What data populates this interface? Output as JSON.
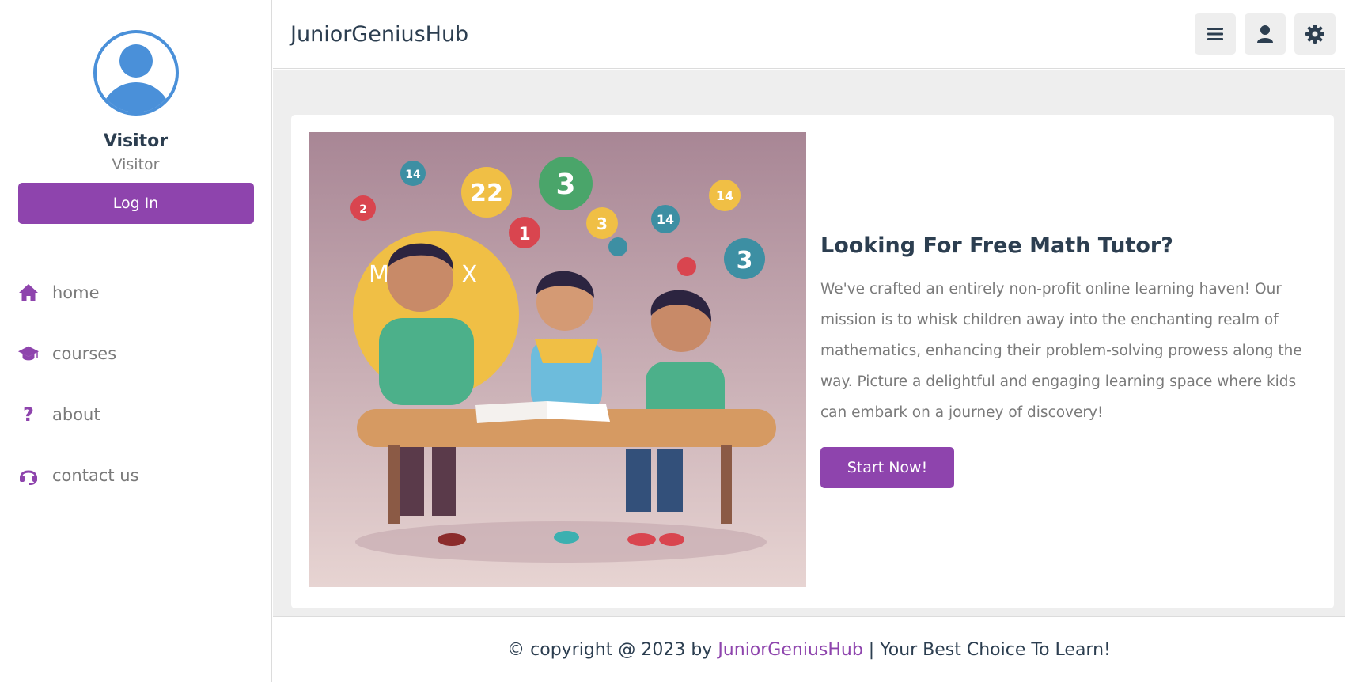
{
  "sidebar": {
    "profile": {
      "name": "Visitor",
      "role": "Visitor",
      "login_label": "Log In"
    },
    "nav": [
      {
        "label": "home",
        "icon": "home-icon"
      },
      {
        "label": "courses",
        "icon": "graduation-cap-icon"
      },
      {
        "label": "about",
        "icon": "question-icon"
      },
      {
        "label": "contact us",
        "icon": "headset-icon"
      }
    ]
  },
  "header": {
    "brand": "JuniorGeniusHub",
    "actions": [
      "menu-icon",
      "user-icon",
      "settings-icon"
    ]
  },
  "hero": {
    "title": "Looking For Free Math Tutor?",
    "description": "We've crafted an entirely non-profit online learning haven! Our mission is to whisk children away into the enchanting realm of mathematics, enhancing their problem-solving prowess along the way. Picture a delightful and engaging learning space where kids can embark on a journey of discovery!",
    "cta_label": "Start Now!",
    "image_subject": "three kids studying math at a table",
    "image_numbers": [
      "14",
      "22",
      "3",
      "1",
      "3",
      "14",
      "14",
      "3",
      "2",
      "M",
      "X"
    ]
  },
  "footer": {
    "prefix": "© copyright @ 2023 by ",
    "brand": "JuniorGeniusHub",
    "suffix": " | Your Best Choice To Learn!"
  },
  "colors": {
    "accent": "#8e44ad",
    "avatar": "#4a90d9",
    "text_dark": "#2c3e50",
    "text_muted": "#7a7a7a",
    "page_bg": "#eeeeee"
  }
}
